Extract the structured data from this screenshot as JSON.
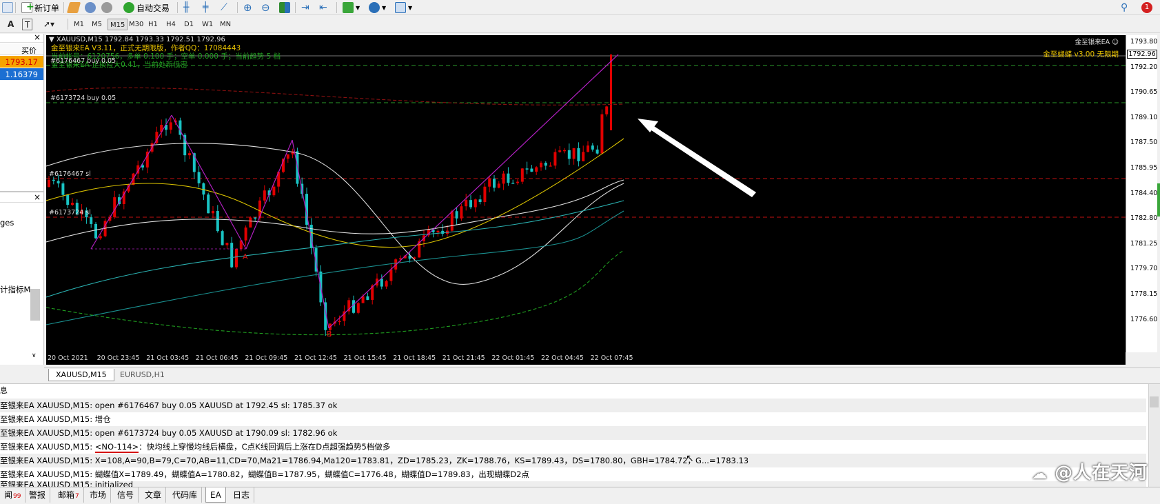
{
  "toolbar": {
    "new_order": "新订单",
    "auto_trading": "自动交易",
    "alert_badge": "1"
  },
  "timeframes": [
    "M1",
    "M5",
    "M15",
    "M30",
    "H1",
    "H4",
    "D1",
    "W1",
    "MN"
  ],
  "timeframe_active": "M15",
  "toolbar2_letters": [
    "A",
    "T"
  ],
  "market_watch": {
    "close": "×",
    "header": "买价",
    "rows": [
      {
        "value": "1793.17",
        "bg": "#f5a400",
        "fg": "#d40000"
      },
      {
        "value": "1.16379",
        "bg": "#1c6fd2",
        "fg": "#ffffff"
      }
    ]
  },
  "navigator": {
    "close": "×",
    "items": [
      "ges",
      "计指标M"
    ]
  },
  "chart": {
    "symbol_line": "▼ XAUUSD,M15  1792.84 1793.33 1792.51 1792.96",
    "ea_line1": "金至银来EA V3.11，正式无期限版，作者QQ：17084443",
    "ea_line2": "当前帐号：6120756，多单 0.100 手；空单 0.000 手；当前趋势 5 档",
    "ea_line3": "金至银来EA 止损拉大0.41，当前处新低密",
    "ea_top_right": "金至银来EA ☺",
    "butterfly_label": "金至蝴蝶 v3.00 无限期",
    "orders": [
      {
        "label": "#6176467 buy 0.05"
      },
      {
        "label": "#6173724 buy 0.05"
      },
      {
        "label": "#6176467 sl"
      },
      {
        "label": "#6173724 sl"
      }
    ],
    "pattern_points": [
      "X",
      "A",
      "B",
      "C",
      "D"
    ],
    "price_ticks": [
      "1793.80",
      "1792.20",
      "1790.65",
      "1789.10",
      "1787.50",
      "1785.95",
      "1784.40",
      "1782.80",
      "1781.25",
      "1779.70",
      "1778.15",
      "1776.60"
    ],
    "current_price": "1792.96",
    "time_ticks": [
      "20 Oct 2021",
      "20 Oct 23:45",
      "21 Oct 03:45",
      "21 Oct 06:45",
      "21 Oct 09:45",
      "21 Oct 12:45",
      "21 Oct 15:45",
      "21 Oct 18:45",
      "21 Oct 21:45",
      "22 Oct 01:45",
      "22 Oct 04:45",
      "22 Oct 07:45"
    ],
    "colors": {
      "bull": "#e00000",
      "bear": "#19c4c4",
      "grid": "#1f4d1f"
    }
  },
  "chart_tabs": [
    "XAUUSD,M15",
    "EURUSD,H1"
  ],
  "terminal": {
    "header_fragment": "息",
    "logs": [
      "至银来EA XAUUSD,M15: open #6176467 buy 0.05 XAUUSD at 1792.45 sl: 1785.37 ok",
      "至银来EA XAUUSD,M15: 增仓",
      "至银来EA XAUUSD,M15: open #6173724 buy 0.05 XAUUSD at 1790.09 sl: 1782.96 ok",
      "至银来EA XAUUSD,M15: ",
      "至银来EA XAUUSD,M15: X=108,A=90,B=79,C=70,AB=11,CD=70,Ma21=1786.94,Ma120=1783.81，ZD=1785.23，ZK=1788.76，KS=1789.43，DS=1780.80，GBH=1784.72，G...=1783.13",
      "至银来EA XAUUSD,M15: 蝴蝶值X=1789.49，蝴蝶值A=1780.82，蝴蝶值B=1787.95，蝴蝶值C=1776.48，蝴蝶值D=1789.83，出现蝴蝶D2点",
      "至银来EA XAUUSD,M15: initialized"
    ],
    "highlight_code": "<NO-114>",
    "highlight_rest": "：快均线上穿慢均线后横盘，C点K线回调后上涨在D点超强趋势5档做多"
  },
  "bottom_tabs": [
    {
      "label": "闻",
      "badge": "99"
    },
    {
      "label": "警报",
      "badge": ""
    },
    {
      "label": "邮箱",
      "badge": "7"
    },
    {
      "label": "市场",
      "badge": ""
    },
    {
      "label": "信号",
      "badge": ""
    },
    {
      "label": "文章",
      "badge": ""
    },
    {
      "label": "代码库",
      "badge": ""
    },
    {
      "label": "EA",
      "badge": ""
    },
    {
      "label": "日志",
      "badge": ""
    }
  ],
  "bottom_tab_active": "EA",
  "watermark": "@人在天河"
}
